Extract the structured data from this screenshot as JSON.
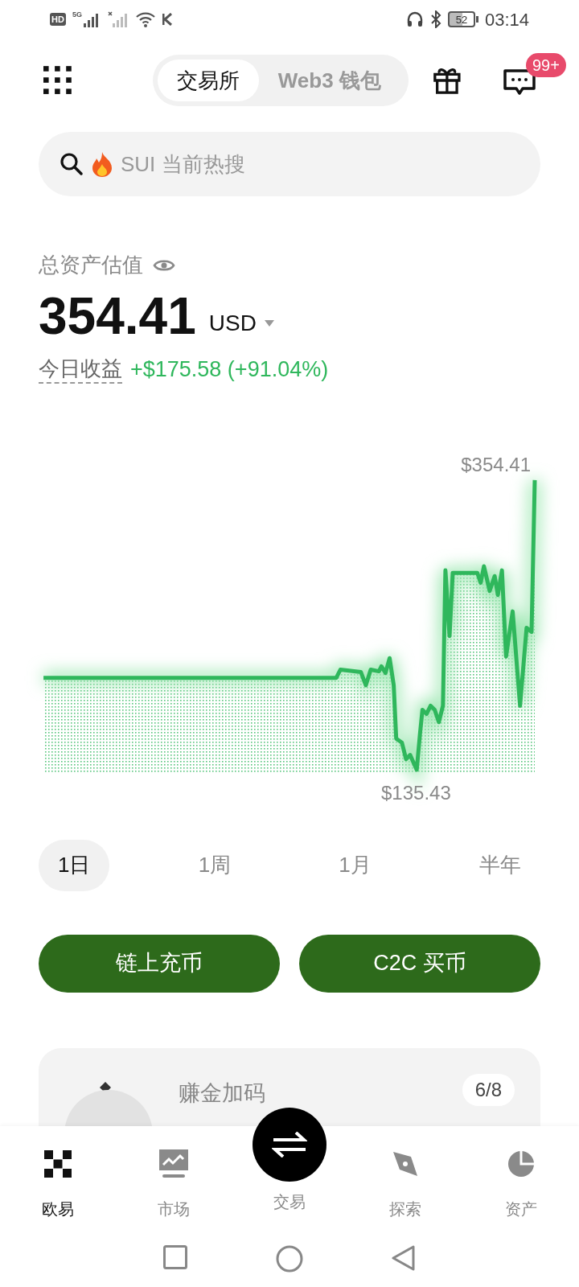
{
  "status_bar": {
    "hd": "HD",
    "network": "5G",
    "battery": "52",
    "time": "03:14"
  },
  "header": {
    "tabs": [
      {
        "label": "交易所",
        "selected": true
      },
      {
        "label": "Web3 钱包",
        "selected": false
      }
    ],
    "message_badge": "99+"
  },
  "search": {
    "placeholder": "SUI 当前热搜"
  },
  "assets": {
    "label": "总资产估值",
    "value": "354.41",
    "currency": "USD",
    "pnl_label": "今日收益",
    "pnl": "+$175.58 (+91.04%)"
  },
  "chart": {
    "max_label": "$354.41",
    "min_label": "$135.43"
  },
  "periods": [
    {
      "label": "1日",
      "selected": true
    },
    {
      "label": "1周",
      "selected": false
    },
    {
      "label": "1月",
      "selected": false
    },
    {
      "label": "半年",
      "selected": false
    }
  ],
  "actions": [
    "链上充币",
    "C2C 买币"
  ],
  "promo": {
    "title": "赚金加码",
    "progress": "6/8"
  },
  "nav": [
    {
      "label": "欧易",
      "selected": true,
      "kind": "logo"
    },
    {
      "label": "市场",
      "selected": false,
      "kind": "market"
    },
    {
      "label": "交易",
      "selected": false,
      "kind": "trade"
    },
    {
      "label": "探索",
      "selected": false,
      "kind": "explore"
    },
    {
      "label": "资产",
      "selected": false,
      "kind": "assets"
    }
  ]
}
